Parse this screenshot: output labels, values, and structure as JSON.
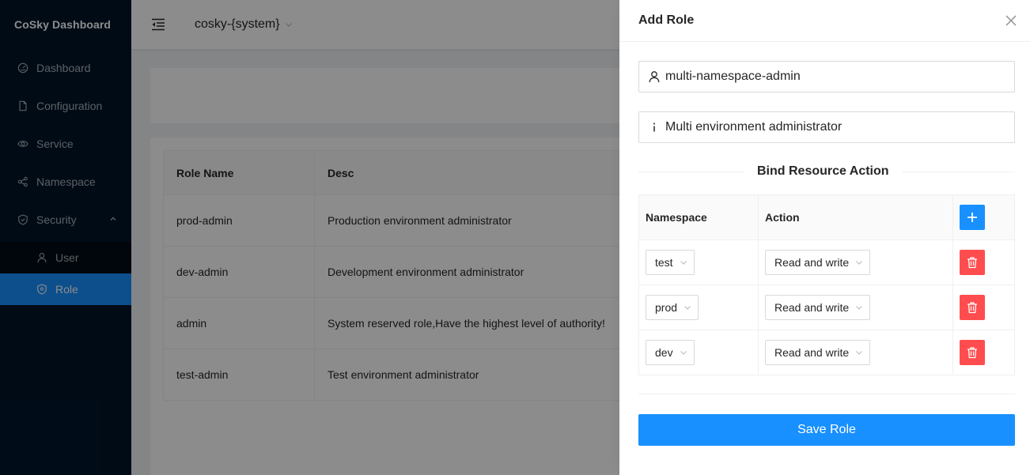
{
  "app": {
    "title": "CoSky Dashboard"
  },
  "sidebar": {
    "items": [
      {
        "label": "Dashboard",
        "icon": "dashboard-icon"
      },
      {
        "label": "Configuration",
        "icon": "file-icon"
      },
      {
        "label": "Service",
        "icon": "eye-icon"
      },
      {
        "label": "Namespace",
        "icon": "cluster-icon"
      },
      {
        "label": "Security",
        "icon": "safety-icon"
      }
    ],
    "security_sub": [
      {
        "label": "User",
        "icon": "user-icon"
      },
      {
        "label": "Role",
        "icon": "shield-icon",
        "selected": true
      }
    ]
  },
  "header": {
    "namespace": "cosky-{system}"
  },
  "roles_table": {
    "columns": [
      "Role Name",
      "Desc"
    ],
    "rows": [
      {
        "name": "prod-admin",
        "desc": "Production environment administrator"
      },
      {
        "name": "dev-admin",
        "desc": "Development environment administrator"
      },
      {
        "name": "admin",
        "desc": "System reserved role,Have the highest level of authority!"
      },
      {
        "name": "test-admin",
        "desc": "Test environment administrator"
      }
    ]
  },
  "drawer": {
    "title": "Add Role",
    "role_name_value": "multi-namespace-admin",
    "desc_value": "Multi environment administrator",
    "divider_label": "Bind Resource Action",
    "bind_table": {
      "columns": [
        "Namespace",
        "Action"
      ],
      "rows": [
        {
          "namespace": "test",
          "action": "Read and write"
        },
        {
          "namespace": "prod",
          "action": "Read and write"
        },
        {
          "namespace": "dev",
          "action": "Read and write"
        }
      ]
    },
    "save_label": "Save Role"
  },
  "colors": {
    "primary": "#1890ff",
    "danger": "#ff4d4f",
    "sider": "#001529"
  }
}
